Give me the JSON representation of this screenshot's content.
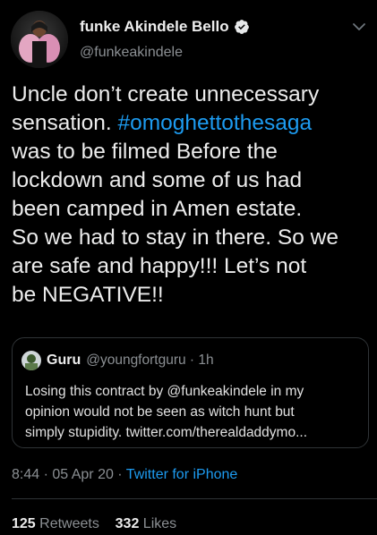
{
  "author": {
    "display_name": "funke Akindele Bello",
    "handle": "@funkeakindele",
    "verified": true,
    "avatar": "profile-photo"
  },
  "tweet": {
    "lines": [
      {
        "text": "Uncle don’t create unnecessary"
      },
      {
        "pre": "sensation. ",
        "hashtag": "#omoghettothesaga"
      },
      {
        "text": "was to be filmed Before the"
      },
      {
        "text": "lockdown and some of us had"
      },
      {
        "text": "been camped in Amen estate."
      },
      {
        "text": "So we had to stay in there. So we"
      },
      {
        "text": "are safe and happy!!! Let’s not"
      },
      {
        "text": "be NEGATIVE!!"
      }
    ]
  },
  "quoted_tweet": {
    "name": "Guru",
    "handle": "@youngfortguru",
    "separator": " · ",
    "time": "1h",
    "lines": [
      "Losing this contract by @funkeakindele in my",
      "opinion would not be seen as witch hunt but",
      "simply stupidity. twitter.com/therealdaddymo..."
    ]
  },
  "meta": {
    "time": "8:44",
    "separator": " · ",
    "date": "05 Apr 20",
    "source": "Twitter for iPhone"
  },
  "stats": {
    "retweets_count": "125",
    "retweets_label": "Retweets",
    "likes_count": "332",
    "likes_label": "Likes"
  },
  "colors": {
    "background": "#000000",
    "link": "#1d9bf0",
    "secondary_text": "#8b8f93",
    "primary_text": "#ececec",
    "border": "#2f3336"
  },
  "icons": {
    "verified": "verified-badge-icon",
    "caret": "chevron-down-icon"
  }
}
